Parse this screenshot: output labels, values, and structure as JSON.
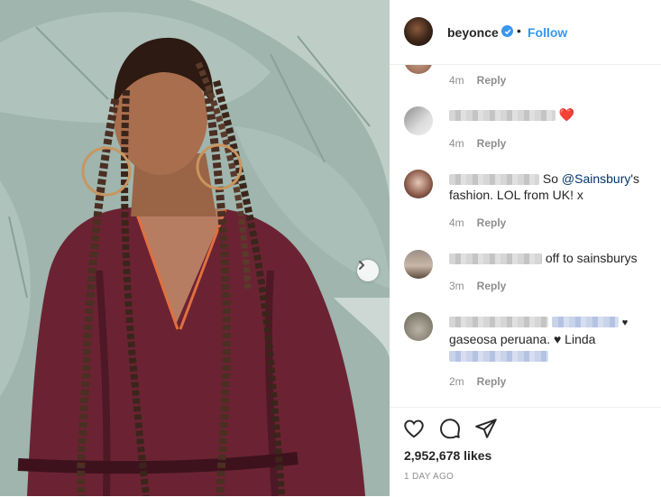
{
  "post": {
    "username": "beyonce",
    "separator": "•",
    "follow_label": "Follow",
    "likes": "2,952,678 likes",
    "timestamp": "1 DAY AGO"
  },
  "comments": [
    {
      "time": "4m",
      "reply": "Reply"
    },
    {
      "text_suffix": "❤️",
      "time": "4m",
      "reply": "Reply"
    },
    {
      "text_before": "So ",
      "mention": "@Sainsbury",
      "text_after": "'s",
      "line2": "fashion. LOL from UK! x",
      "time": "4m",
      "reply": "Reply"
    },
    {
      "text": "off to sainsburys",
      "time": "3m",
      "reply": "Reply"
    },
    {
      "heart": "♥",
      "line2": "gaseosa peruana. ♥ Linda",
      "time": "2m",
      "reply": "Reply"
    }
  ],
  "icons": {
    "verified": "verified-badge-icon",
    "next": "chevron-right-icon",
    "like": "heart-outline-icon",
    "comment": "speech-bubble-icon",
    "share": "paper-plane-icon"
  },
  "colors": {
    "accent": "#3897f0",
    "text": "#262626",
    "muted": "#8e8e8e",
    "mention": "#003569",
    "heart": "#ed4956"
  }
}
